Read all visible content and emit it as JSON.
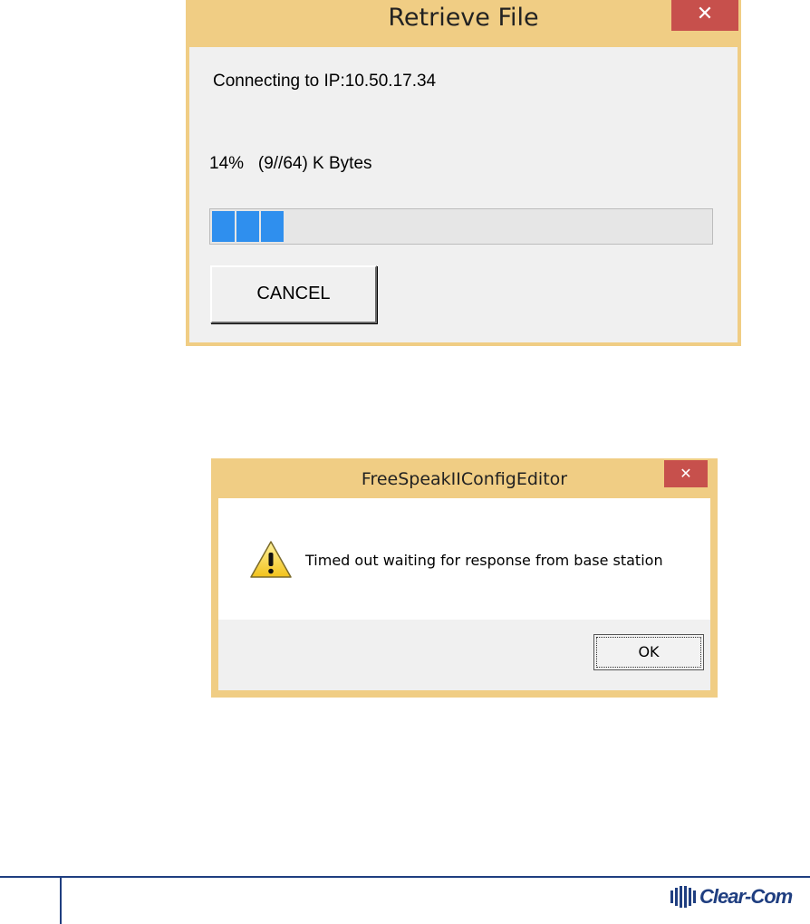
{
  "retrieve_dialog": {
    "title": "Retrieve File",
    "close_label": "✕",
    "connection_text": "Connecting to IP:10.50.17.34",
    "progress_text": "14%   (9//64) K Bytes",
    "progress_fraction": 0.14,
    "cancel_label": "CANCEL"
  },
  "error_dialog": {
    "title": "FreeSpeakIIConfigEditor",
    "close_label": "✕",
    "message": "Timed out waiting for response from base station",
    "icon": "warning-icon",
    "ok_label": "OK"
  },
  "footer": {
    "logo_text": "Clear-Com"
  },
  "colors": {
    "titlebar": "#f0cd84",
    "close_button": "#c7504c",
    "progress": "#2f8fee",
    "brand": "#1f3e80"
  }
}
